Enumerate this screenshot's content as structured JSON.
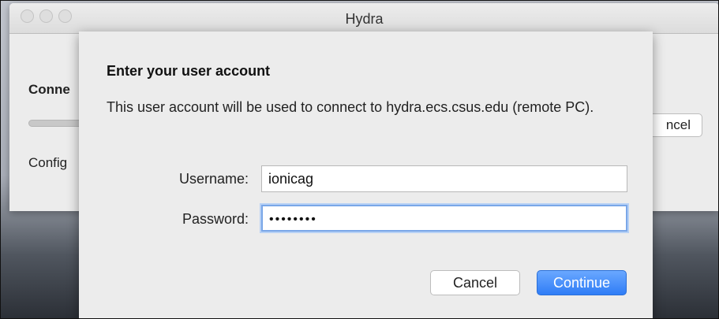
{
  "window": {
    "title": "Hydra",
    "bg_heading": "Conne",
    "bg_config_text": "Config",
    "bg_cancel_label": "ncel"
  },
  "sheet": {
    "heading": "Enter your user account",
    "message": "This user account will be used to connect to hydra.ecs.csus.edu (remote PC).",
    "username_label": "Username:",
    "username_value": "ionicag",
    "password_label": "Password:",
    "password_masked": "••••••••",
    "cancel_label": "Cancel",
    "continue_label": "Continue"
  },
  "colors": {
    "accent": "#2f7df6",
    "focus_ring": "#7aa7e8"
  }
}
